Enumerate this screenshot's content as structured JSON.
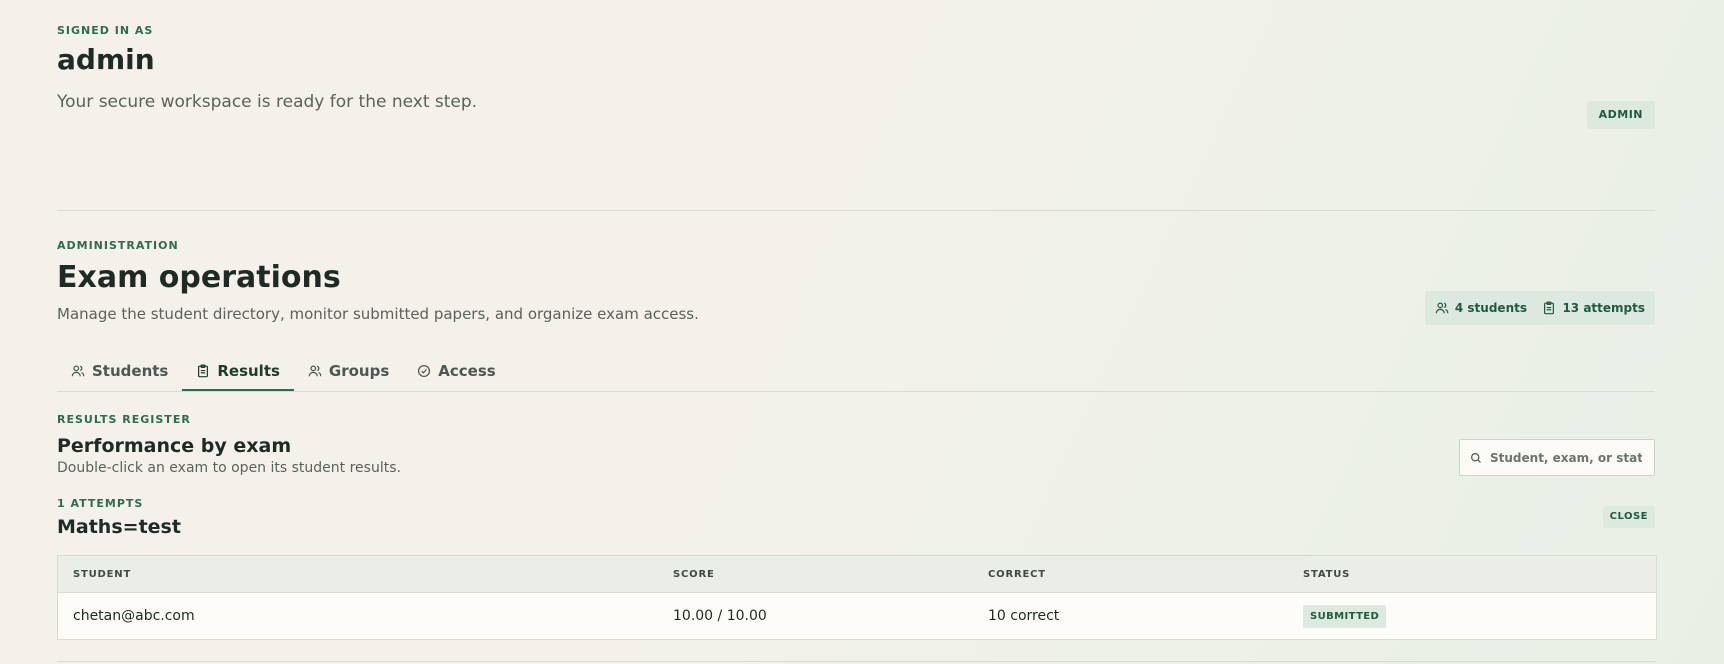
{
  "hero": {
    "eyebrow": "SIGNED IN AS",
    "username": "admin",
    "subtitle": "Your secure workspace is ready for the next step.",
    "role_badge": "ADMIN"
  },
  "admin": {
    "eyebrow": "ADMINISTRATION",
    "title": "Exam operations",
    "description": "Manage the student directory, monitor submitted papers, and organize exam access.",
    "stats": {
      "students": "4 students",
      "attempts": "13 attempts"
    }
  },
  "tabs": [
    {
      "label": "Students",
      "icon": "users-icon"
    },
    {
      "label": "Results",
      "icon": "clipboard-icon",
      "active": true
    },
    {
      "label": "Groups",
      "icon": "users-icon"
    },
    {
      "label": "Access",
      "icon": "check-circle-icon"
    }
  ],
  "results": {
    "eyebrow": "RESULTS REGISTER",
    "title": "Performance by exam",
    "hint": "Double-click an exam to open its student results.",
    "search_placeholder": "Student, exam, or status"
  },
  "exam": {
    "attempts_label": "1 ATTEMPTS",
    "name": "Maths=test",
    "close_label": "CLOSE"
  },
  "table": {
    "columns": [
      "STUDENT",
      "SCORE",
      "CORRECT",
      "STATUS"
    ],
    "rows": [
      {
        "student": "chetan@abc.com",
        "score": "10.00 / 10.00",
        "correct": "10 correct",
        "status": "SUBMITTED"
      }
    ]
  },
  "colors": {
    "accent": "#2f6b4c",
    "badge_bg": "#dde9df",
    "background": "#f3f1ea"
  }
}
